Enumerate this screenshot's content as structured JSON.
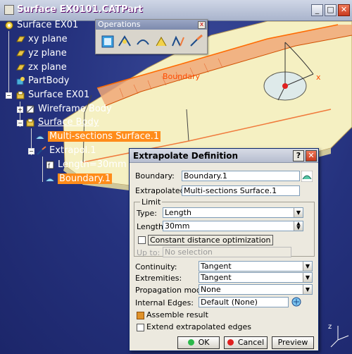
{
  "window": {
    "title": "Surface EX0101.CATPart",
    "buttons": {
      "minimize": "_",
      "maximize": "□",
      "close": "✕"
    }
  },
  "tree": {
    "root": "Surface EX01",
    "xy": "xy plane",
    "yz": "yz plane",
    "zx": "zx plane",
    "partbody": "PartBody",
    "surface_ex01": "Surface EX01",
    "wireframe": "Wireframe Body",
    "surface_body": "Surface Body",
    "multisections": "Multi-sections Surface.1",
    "extrapol": "Extrapol.1",
    "length": "Length=30mm",
    "boundary": "Boundary.1"
  },
  "operations": {
    "title": "Operations",
    "close": "x"
  },
  "viewport": {
    "boundary_label": "Boundary",
    "axis_x": "x",
    "axis_z": "z"
  },
  "dialog": {
    "title": "Extrapolate Definition",
    "help": "?",
    "close": "✕",
    "boundary_label": "Boundary:",
    "boundary_value": "Boundary.1",
    "extrapolated_label": "Extrapolated:",
    "extrapolated_value": "Multi-sections Surface.1",
    "limit_group": "Limit",
    "type_label": "Type:",
    "type_value": "Length",
    "length_label": "Length:",
    "length_value": "30mm",
    "constant_distance": "Constant distance optimization",
    "upto_label": "Up to:",
    "upto_value": "No selection",
    "continuity_label": "Continuity:",
    "continuity_value": "Tangent",
    "extremities_label": "Extremities:",
    "extremities_value": "Tangent",
    "propagation_label": "Propagation mode:",
    "propagation_value": "None",
    "internal_label": "Internal Edges:",
    "internal_value": "Default (None)",
    "assemble_label": "Assemble result",
    "assemble_checked": true,
    "extend_label": "Extend extrapolated edges",
    "extend_checked": false,
    "ok_label": "OK",
    "cancel_label": "Cancel",
    "preview_label": "Preview"
  },
  "colors": {
    "tree_highlight": "#ff8c1a",
    "viewport_bg": "#25327e",
    "surface": "#f4efbd"
  }
}
